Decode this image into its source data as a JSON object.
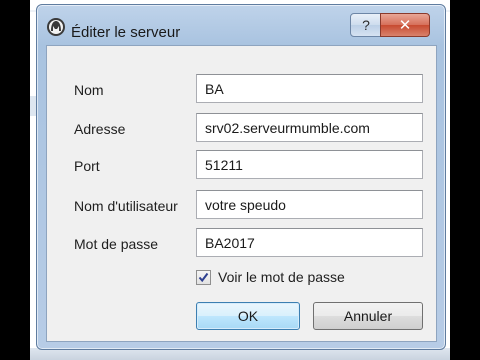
{
  "dialog": {
    "title": "Éditer le serveur",
    "help_glyph": "?",
    "close_glyph": "✕"
  },
  "form": {
    "name_label": "Nom",
    "name_value": "BA",
    "address_label": "Adresse",
    "address_value": "srv02.serveurmumble.com",
    "port_label": "Port",
    "port_value": "51211",
    "username_label": "Nom d'utilisateur",
    "username_value": "votre speudo",
    "password_label": "Mot de passe",
    "password_value": "BA2017",
    "show_password_label": "Voir le mot de passe",
    "show_password_checked": true
  },
  "buttons": {
    "ok_label": "OK",
    "cancel_label": "Annuler"
  },
  "colors": {
    "accent": "#3c7fb1",
    "close_red": "#c74a30",
    "title_bar": "#bfd3ea"
  },
  "icons": {
    "app": "mumble-logo-icon",
    "checkmark": "check-icon"
  }
}
